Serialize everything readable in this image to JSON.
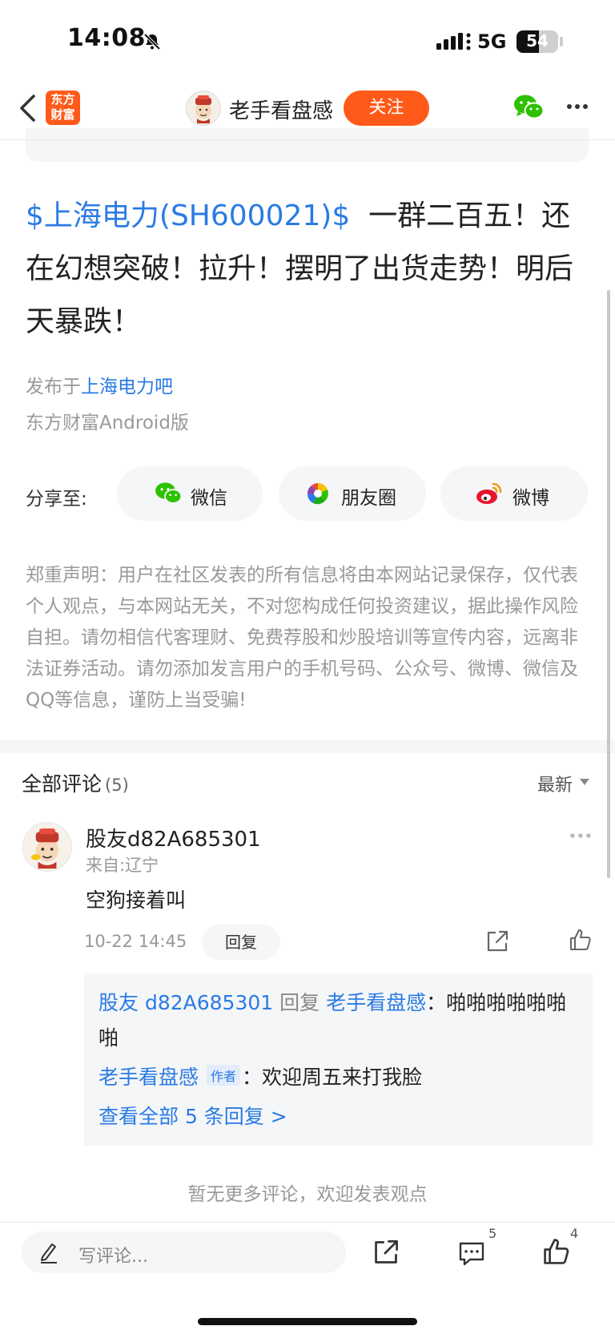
{
  "status_bar": {
    "time": "14:08",
    "network": "5G",
    "battery": "54"
  },
  "nav": {
    "logo_line1": "东方",
    "logo_line2": "财富",
    "author_name": "老手看盘感",
    "follow_label": "关注"
  },
  "post": {
    "stock_tag": "$上海电力(SH600021)$",
    "content": "一群二百五！还在幻想突破！拉升！摆明了出货走势！明后天暴跌！",
    "published_prefix": "发布于",
    "published_bar": "上海电力吧",
    "client": "东方财富Android版"
  },
  "share": {
    "label": "分享至:",
    "options": [
      "微信",
      "朋友圈",
      "微博"
    ]
  },
  "disclaimer": "郑重声明：用户在社区发表的所有信息将由本网站记录保存，仅代表个人观点，与本网站无关，不对您构成任何投资建议，据此操作风险自担。请勿相信代客理财、免费荐股和炒股培训等宣传内容，远离非法证券活动。请勿添加发言用户的手机号码、公众号、微博、微信及QQ等信息，谨防上当受骗!",
  "comments": {
    "title": "全部评论",
    "count": "(5)",
    "sort_label": "最新",
    "items": [
      {
        "user": "股友d82A685301",
        "location": "来自:辽宁",
        "text": "空狗接着叫",
        "time": "10-22 14:45",
        "reply_label": "回复",
        "replies": [
          {
            "from": "股友 d82A685301",
            "verb": "回复",
            "to": "老手看盘感",
            "sep": "：",
            "text": "啪啪啪啪啪啪啪"
          },
          {
            "from": "老手看盘感",
            "tag": "作者",
            "sep": "：",
            "text": "欢迎周五来打我脸"
          }
        ],
        "view_all": "查看全部 5 条回复 >"
      }
    ],
    "no_more": "暂无更多评论，欢迎发表观点"
  },
  "bottom_bar": {
    "write_placeholder": "写评论...",
    "comment_count": "5",
    "like_count": "4"
  },
  "colors": {
    "accent": "#ff5a19",
    "link": "#2a7be4",
    "muted": "#999999"
  }
}
